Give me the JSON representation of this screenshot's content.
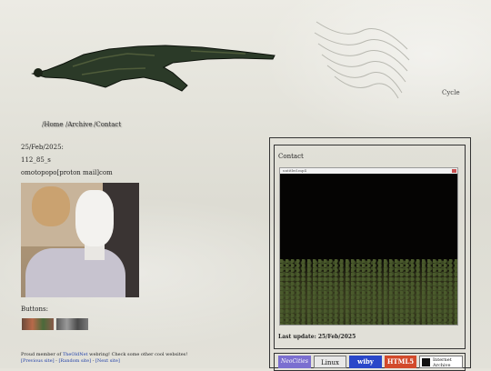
{
  "header": {
    "cycle_label": "Cycle"
  },
  "nav": {
    "items": [
      {
        "label": "/Home"
      },
      {
        "label": "/Archive"
      },
      {
        "label": "/Contact"
      }
    ]
  },
  "post": {
    "date": "25/Feb/2025:",
    "id": "112_85_s",
    "email": "omotopopo[proton mail]com"
  },
  "buttons_section": {
    "heading": "Buttons:"
  },
  "footer": {
    "line_prefix": "Proud member of",
    "webring_name": "TheOldNet",
    "line_suffix": "webring! Check some other cool websites!",
    "prev_link": "[Previous site]",
    "random_link": "[Random site]",
    "next_link": "[Next site]",
    "separator": " - "
  },
  "sidebar": {
    "title": "Contact",
    "video_title": "untitled.mp4",
    "last_update": "Last update: 25/Feb/2025"
  },
  "badges": [
    {
      "label": "NeoCities",
      "bg": "#7b6fd0",
      "fg": "#ffffff"
    },
    {
      "label": "Linux",
      "bg": "#e8e8e8",
      "fg": "#111111"
    },
    {
      "label": "wiby",
      "bg": "#2a47c9",
      "fg": "#ffffff"
    },
    {
      "label": "HTML5",
      "bg": "#d24a2b",
      "fg": "#ffffff"
    },
    {
      "label": "Internet Archive",
      "bg": "#ffffff",
      "fg": "#111111"
    }
  ]
}
